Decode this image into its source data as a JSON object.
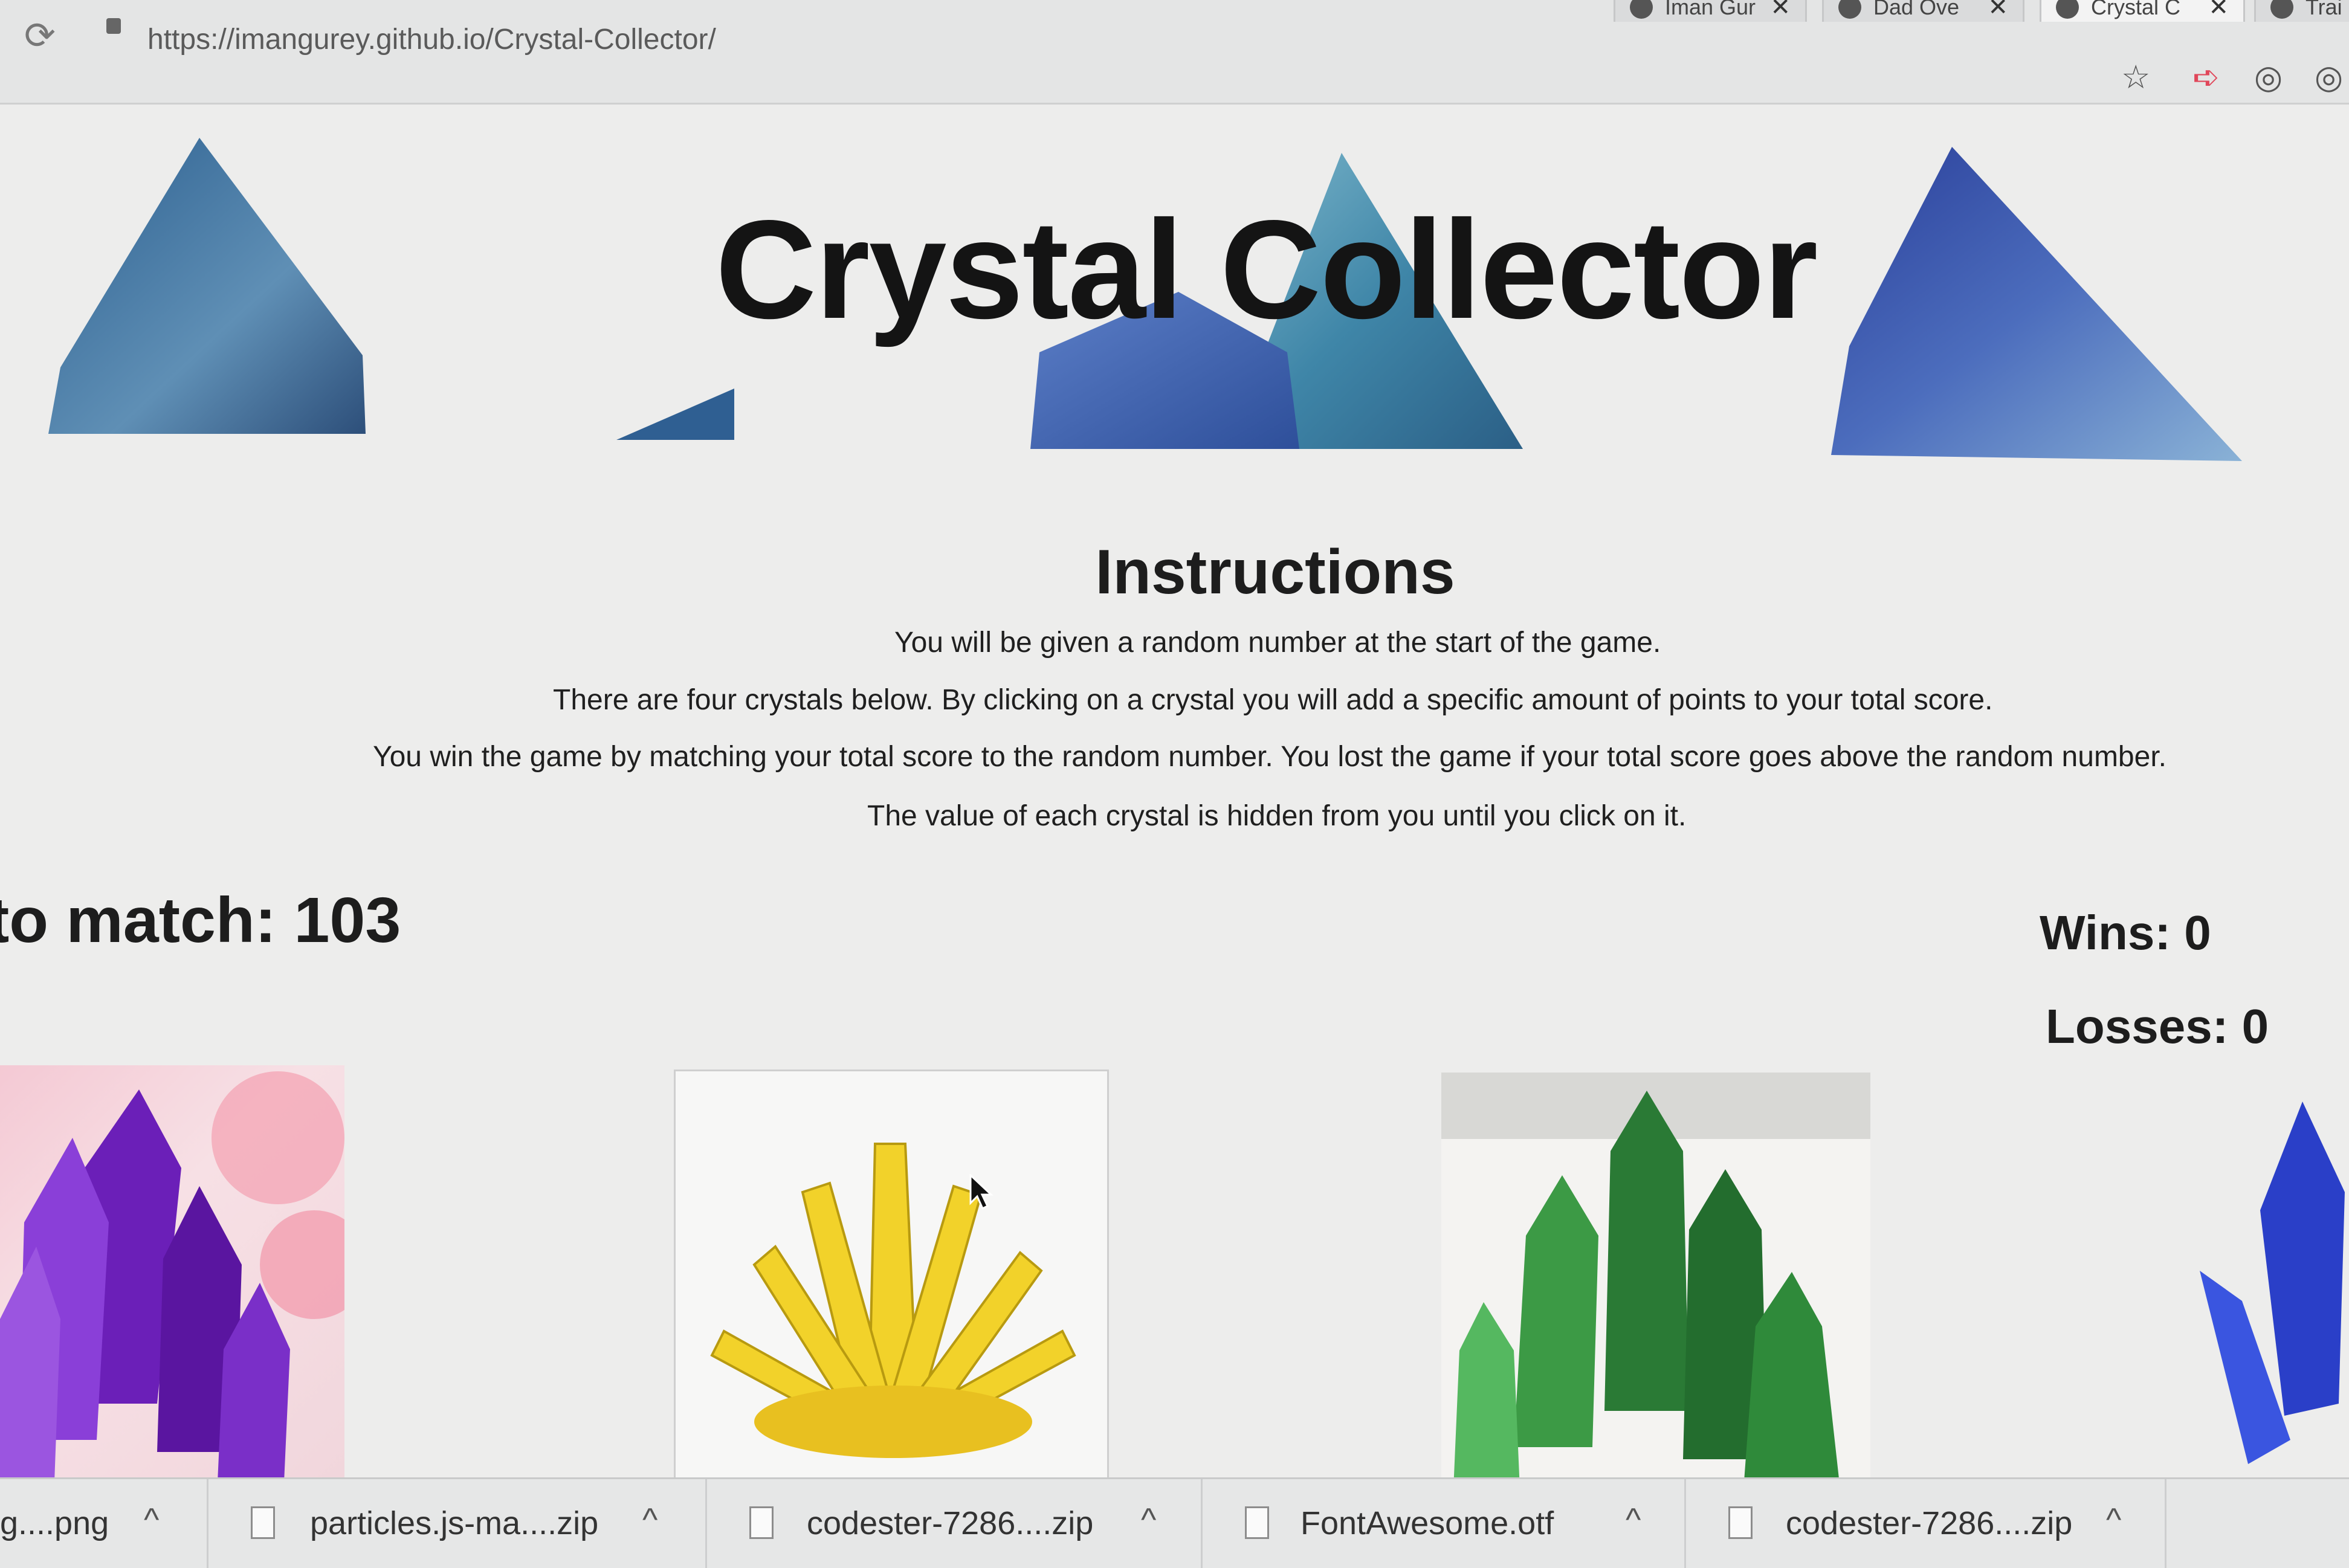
{
  "browser": {
    "tabs": [
      {
        "label": "Iman Gur"
      },
      {
        "label": "Dad Ove"
      },
      {
        "label": "Crystal C"
      },
      {
        "label": "Trai"
      }
    ],
    "url": "https://imangurey.github.io/Crystal-Collector/"
  },
  "page": {
    "title": "Crystal Collector",
    "instructions": {
      "heading": "Instructions",
      "lines": [
        "You will be given a random number at the start of the game.",
        "There are four crystals below. By clicking on a crystal you will add a specific amount of points to your total score.",
        "You win the game by matching your total score to the random number. You lost the game if your total score goes above the random number.",
        "The value of each crystal is hidden from you until you click on it."
      ]
    },
    "target_label": "to match: 103",
    "wins_label": "Wins: 0",
    "losses_label": "Losses: 0",
    "crystals": [
      "purple-crystal",
      "yellow-crystal",
      "green-crystal",
      "blue-crystal"
    ]
  },
  "downloads": [
    {
      "name": "g....png"
    },
    {
      "name": "particles.js-ma....zip"
    },
    {
      "name": "codester-7286....zip"
    },
    {
      "name": "FontAwesome.otf"
    },
    {
      "name": "codester-7286....zip"
    }
  ],
  "colors": {
    "background": "#ededec",
    "title_text": "#141414",
    "crystal_purple": "#7a2fc8",
    "crystal_yellow": "#f2d22a",
    "crystal_green": "#2f8a3a",
    "crystal_blue": "#2a3fc8"
  }
}
